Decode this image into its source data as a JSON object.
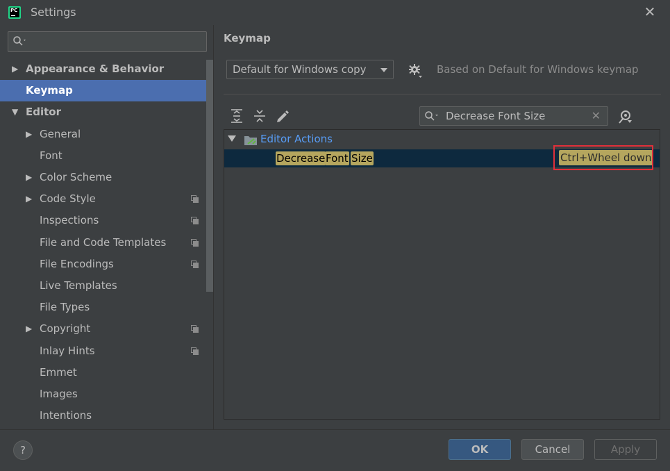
{
  "window": {
    "title": "Settings",
    "app_icon_text": "PC"
  },
  "sidebar": {
    "search_value": "",
    "items": [
      {
        "label": "Appearance & Behavior",
        "bold": true,
        "arrow": "collapsed",
        "indent": 0,
        "selected": false,
        "has_copy": false
      },
      {
        "label": "Keymap",
        "bold": true,
        "arrow": "none",
        "indent": 0,
        "selected": true,
        "has_copy": false
      },
      {
        "label": "Editor",
        "bold": true,
        "arrow": "expanded",
        "indent": 0,
        "selected": false,
        "has_copy": false
      },
      {
        "label": "General",
        "bold": false,
        "arrow": "collapsed",
        "indent": 1,
        "selected": false,
        "has_copy": false
      },
      {
        "label": "Font",
        "bold": false,
        "arrow": "none",
        "indent": 1,
        "selected": false,
        "has_copy": false
      },
      {
        "label": "Color Scheme",
        "bold": false,
        "arrow": "collapsed",
        "indent": 1,
        "selected": false,
        "has_copy": false
      },
      {
        "label": "Code Style",
        "bold": false,
        "arrow": "collapsed",
        "indent": 1,
        "selected": false,
        "has_copy": true
      },
      {
        "label": "Inspections",
        "bold": false,
        "arrow": "none",
        "indent": 1,
        "selected": false,
        "has_copy": true
      },
      {
        "label": "File and Code Templates",
        "bold": false,
        "arrow": "none",
        "indent": 1,
        "selected": false,
        "has_copy": true
      },
      {
        "label": "File Encodings",
        "bold": false,
        "arrow": "none",
        "indent": 1,
        "selected": false,
        "has_copy": true
      },
      {
        "label": "Live Templates",
        "bold": false,
        "arrow": "none",
        "indent": 1,
        "selected": false,
        "has_copy": false
      },
      {
        "label": "File Types",
        "bold": false,
        "arrow": "none",
        "indent": 1,
        "selected": false,
        "has_copy": false
      },
      {
        "label": "Copyright",
        "bold": false,
        "arrow": "collapsed",
        "indent": 1,
        "selected": false,
        "has_copy": true
      },
      {
        "label": "Inlay Hints",
        "bold": false,
        "arrow": "none",
        "indent": 1,
        "selected": false,
        "has_copy": true
      },
      {
        "label": "Emmet",
        "bold": false,
        "arrow": "none",
        "indent": 1,
        "selected": false,
        "has_copy": false
      },
      {
        "label": "Images",
        "bold": false,
        "arrow": "none",
        "indent": 1,
        "selected": false,
        "has_copy": false
      },
      {
        "label": "Intentions",
        "bold": false,
        "arrow": "none",
        "indent": 1,
        "selected": false,
        "has_copy": false
      }
    ]
  },
  "keymap": {
    "heading": "Keymap",
    "scheme_selected": "Default for Windows copy",
    "based_on": "Based on Default for Windows keymap",
    "filter_value": "Decrease Font Size",
    "tree": {
      "group_label": "Editor Actions",
      "action_words": [
        "Decrease",
        "Font",
        "Size"
      ],
      "shortcut": "Ctrl+Wheel down"
    }
  },
  "footer": {
    "help_label": "?",
    "ok_label": "OK",
    "cancel_label": "Cancel",
    "apply_label": "Apply"
  },
  "colors": {
    "background": "#3c3f41",
    "selection": "#4b6eaf",
    "highlight": "#b5a65e",
    "link": "#589df6",
    "annotation_box": "#e0303a"
  }
}
